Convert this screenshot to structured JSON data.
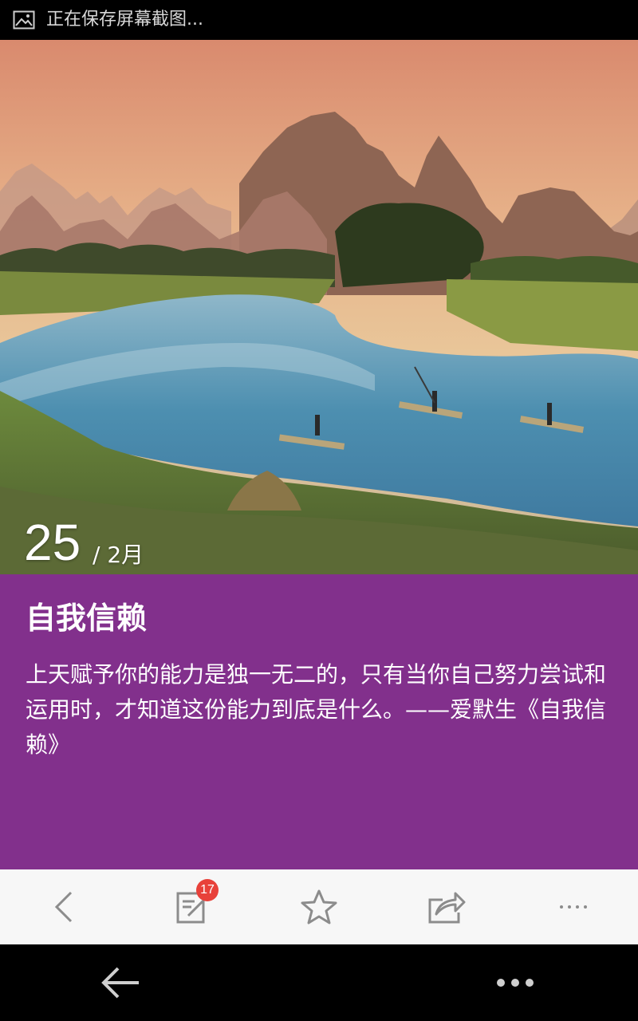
{
  "status_bar": {
    "icon": "image-icon",
    "text": "正在保存屏幕截图..."
  },
  "hero": {
    "day": "25",
    "month": "/ 2月"
  },
  "card": {
    "background": "#82308c",
    "title": "自我信赖",
    "body": "上天赋予你的能力是独一无二的，只有当你自己努力尝试和运用时，才知道这份能力到底是什么。——爱默生《自我信赖》"
  },
  "toolbar": {
    "items": [
      {
        "icon": "chevron-left-icon"
      },
      {
        "icon": "edit-note-icon",
        "badge": "17"
      },
      {
        "icon": "star-icon"
      },
      {
        "icon": "share-icon"
      },
      {
        "icon": "more-dots-icon"
      }
    ]
  },
  "nav_bar": {
    "back_icon": "back-arrow-icon",
    "menu_icon": "menu-dots-icon"
  }
}
